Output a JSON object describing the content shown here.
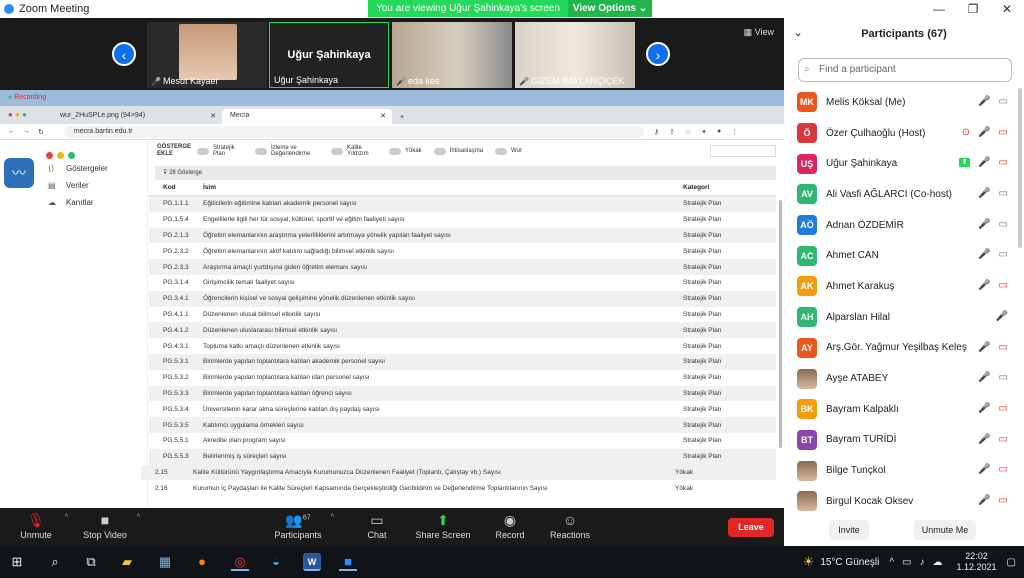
{
  "window": {
    "title": "Zoom Meeting",
    "controls": [
      "—",
      "❐",
      "✕"
    ]
  },
  "banner": {
    "text": "You are viewing Uğur Şahinkaya's screen",
    "options": "View Options ⌄"
  },
  "strip": {
    "view_label": "View",
    "tiles": [
      {
        "name": "Mesut Kayaer"
      },
      {
        "name": "Uğur Şahinkaya",
        "big": "Uğur Şahinkaya"
      },
      {
        "name": "eda kes"
      },
      {
        "name": "GİZEM BAYLANÇIÇEK"
      }
    ]
  },
  "share": {
    "recording": "Recording",
    "browser": {
      "tabs": [
        {
          "title": "wur_2HuSPLe.png (94×94)"
        },
        {
          "title": "Mecra"
        }
      ],
      "url": "mecra.bartin.edu.tr"
    },
    "sidebar": {
      "items": [
        {
          "icon": "⟨⟩",
          "label": "Göstergeler"
        },
        {
          "icon": "▤",
          "label": "Veriler"
        },
        {
          "icon": "☁",
          "label": "Kanıtlar"
        }
      ]
    },
    "filters": {
      "label": "GÖSTERGE EKLE",
      "toggles": [
        {
          "label": "Stratejik Plan"
        },
        {
          "label": "İzleme ve Değerlendirme"
        },
        {
          "label": "Kalite Yıldızım"
        },
        {
          "label": "Yökak"
        },
        {
          "label": "İhtisaslaşma"
        },
        {
          "label": "Wur"
        }
      ]
    },
    "count": "28 Gösterge",
    "table": {
      "headers": [
        "Kod",
        "İsim",
        "Kategori"
      ],
      "rows": [
        [
          "PG.1.1.1",
          "Eğiticilerin eğitimine katılan akademik personel sayısı",
          "Stratejik Plan"
        ],
        [
          "PG.1.5.4",
          "Engellilerle ilgili her tür sosyal, kültürel, sportif ve eğitim faaliyeti sayısı",
          "Stratejik Plan"
        ],
        [
          "PG.2.1.3",
          "Öğretim elemanlarının araştırma yeterliliklerini artırmaya yönelik yapılan faaliyet sayısı",
          "Stratejik Plan"
        ],
        [
          "PG.2.3.2",
          "Öğretim elemanlarının aktif katılım sağladığı bilimsel etkinlik sayısı",
          "Stratejik Plan"
        ],
        [
          "PG.2.3.3",
          "Araştırma amaçlı yurtdışına giden öğretim elemanı sayısı",
          "Stratejik Plan"
        ],
        [
          "PG.3.1.4",
          "Girişimcilik temalı faaliyet sayısı",
          "Stratejik Plan"
        ],
        [
          "PG.3.4.1",
          "Öğrencilerin kişisel ve sosyal gelişimine yönelik düzenlenen etkinlik sayısı",
          "Stratejik Plan"
        ],
        [
          "PG.4.1.1",
          "Düzenlenen ulusal bilimsel etkinlik sayısı",
          "Stratejik Plan"
        ],
        [
          "PG.4.1.2",
          "Düzenlenen uluslararası bilimsel etkinlik sayısı",
          "Stratejik Plan"
        ],
        [
          "PG.4.3.1",
          "Topluma katkı amaçlı düzenlenen etkinlik sayısı",
          "Stratejik Plan"
        ],
        [
          "PG.5.3.1",
          "Birimlerde yapılan toplantılara katılan akademik personel sayısı",
          "Stratejik Plan"
        ],
        [
          "PG.5.3.2",
          "Birimlerde yapılan toplantılara katılan idari personel sayısı",
          "Stratejik Plan"
        ],
        [
          "PG.5.3.3",
          "Birimlerde yapılan toplantılara katılan öğrenci sayısı",
          "Stratejik Plan"
        ],
        [
          "PG.5.3.4",
          "Üniversitenin karar alma süreçlerine katılan dış paydaş sayısı",
          "Stratejik Plan"
        ],
        [
          "PG.5.3.5",
          "Katılımcı uygulama örnekleri sayısı",
          "Stratejik Plan"
        ],
        [
          "PG.5.5.1",
          "Akredite olan program sayısı",
          "Stratejik Plan"
        ],
        [
          "PG.5.5.3",
          "Belirlenmiş iş süreçleri sayısı",
          "Stratejik Plan"
        ]
      ],
      "rows2": [
        [
          "2.15",
          "Kalite Kültürünü Yaygınlaştırma Amacıyla Kurumunuzca Düzenlenen Faaliyet (Toplantı, Çalıştay vb.) Sayısı",
          "Yökak"
        ],
        [
          "2.16",
          "Kurumun İç Paydaşları ile Kalite Süreçleri Kapsamında Gerçekleştirdiği Geribildirim ve Değerlendirme Toplantılarının Sayısı",
          "Yökak"
        ]
      ]
    }
  },
  "controls": {
    "unmute": "Unmute",
    "stop_video": "Stop Video",
    "participants": "Participants",
    "participants_count": "67",
    "chat": "Chat",
    "share_screen": "Share Screen",
    "record": "Record",
    "reactions": "Reactions",
    "leave": "Leave"
  },
  "panel": {
    "title": "Participants (67)",
    "search_placeholder": "Find a participant",
    "invite": "Invite",
    "unmute_me": "Unmute Me",
    "participants": [
      {
        "initials": "MK",
        "color": "#e8581c",
        "name": "Melis Köksal (Me)"
      },
      {
        "initials": "Ö",
        "color": "#d9363e",
        "name": "Özer Çulhaoğlu (Host)"
      },
      {
        "initials": "UŞ",
        "color": "#e0245e",
        "name": "Uğur Şahinkaya"
      },
      {
        "initials": "AV",
        "color": "#2eb872",
        "name": "Ali Vasfi AĞLARCI (Co-host)"
      },
      {
        "initials": "AÖ",
        "color": "#1f7ce0",
        "name": "Adnan ÖZDEMİR"
      },
      {
        "initials": "AC",
        "color": "#2eb872",
        "name": "Ahmet CAN"
      },
      {
        "initials": "AK",
        "color": "#f39c12",
        "name": "Ahmet Karakuş"
      },
      {
        "initials": "AH",
        "color": "#2eb872",
        "name": "Alparslan Hilal"
      },
      {
        "initials": "AY",
        "color": "#e8581c",
        "name": "Arş.Gör. Yağmur Yeşilbaş Keleş"
      },
      {
        "initials": "",
        "color": "",
        "name": "Ayşe ATABEY"
      },
      {
        "initials": "BK",
        "color": "#f39c12",
        "name": "Bayram Kalpaklı"
      },
      {
        "initials": "BT",
        "color": "#8e44ad",
        "name": "Bayram TURİDİ"
      },
      {
        "initials": "",
        "color": "",
        "name": "Bilge Tunçkol"
      },
      {
        "initials": "",
        "color": "",
        "name": "Birgul Kocak Oksev"
      }
    ]
  },
  "taskbar": {
    "weather": "15°C Güneşli",
    "time": "22:02",
    "date": "1.12.2021"
  }
}
